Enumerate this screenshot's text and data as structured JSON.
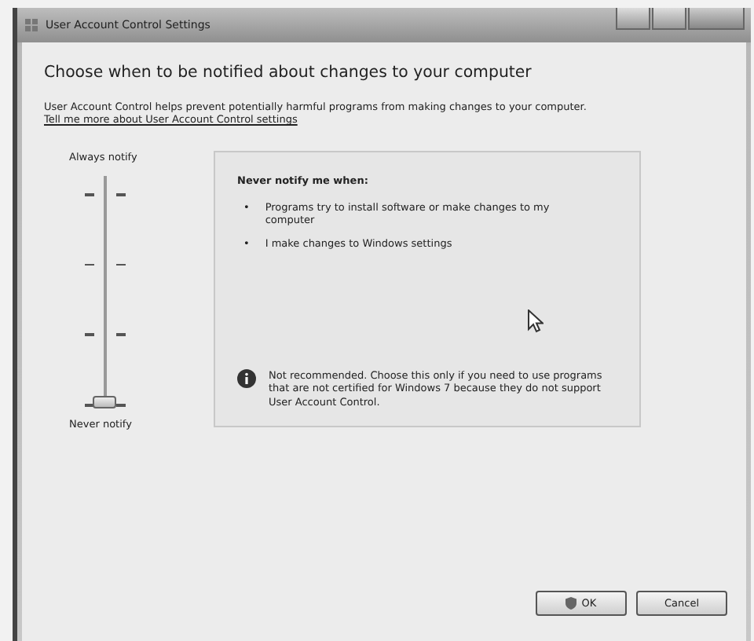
{
  "window": {
    "title": "User Account Control Settings"
  },
  "heading": "Choose when to be notified about changes to your computer",
  "description": "User Account Control helps prevent potentially harmful programs from making changes to your computer.",
  "link": "Tell me more about User Account Control settings",
  "slider": {
    "top_label": "Always notify",
    "bottom_label": "Never notify",
    "level": 0
  },
  "info": {
    "title": "Never notify me when:",
    "bullets": [
      {
        "marker": "•",
        "text": "Programs try to install software or make changes to my computer"
      },
      {
        "marker": "•",
        "text": "I make changes to Windows settings"
      }
    ],
    "note": "Not recommended. Choose this only if you need to use programs that are not certified for Windows 7 because they do not support User Account Control."
  },
  "buttons": [
    {
      "label": "OK",
      "kind": "shield"
    },
    {
      "label": "Cancel",
      "kind": "plain"
    }
  ]
}
